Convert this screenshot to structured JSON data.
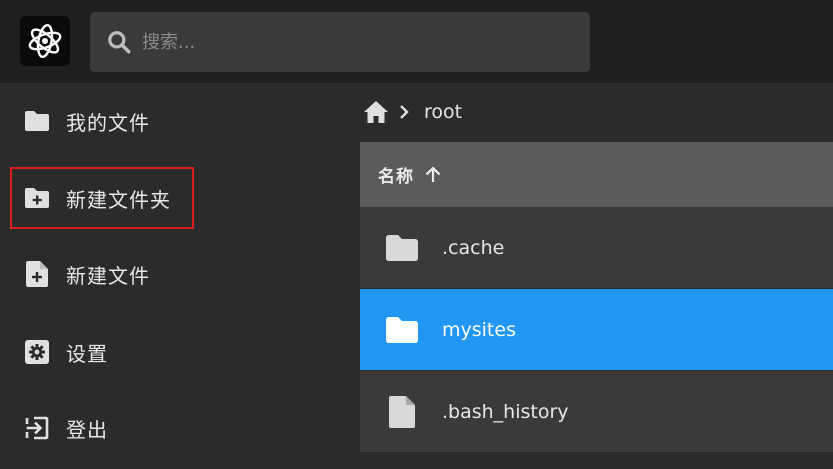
{
  "search": {
    "placeholder": "搜索..."
  },
  "sidebar": {
    "items": [
      {
        "label": "我的文件",
        "icon": "folder-icon"
      },
      {
        "label": "新建文件夹",
        "icon": "folder-plus-icon"
      },
      {
        "label": "新建文件",
        "icon": "file-plus-icon"
      },
      {
        "label": "设置",
        "icon": "gear-icon"
      },
      {
        "label": "登出",
        "icon": "logout-icon"
      }
    ]
  },
  "breadcrumb": {
    "home_icon": "home-icon",
    "path": "root"
  },
  "file_list": {
    "sort_label": "名称",
    "sort_direction_icon": "arrow-up-icon",
    "rows": [
      {
        "name": ".cache",
        "type": "folder",
        "selected": false
      },
      {
        "name": "mysites",
        "type": "folder",
        "selected": true
      },
      {
        "name": ".bash_history",
        "type": "file",
        "selected": false
      }
    ]
  },
  "colors": {
    "topbar": "#1f1f1f",
    "background": "#2b2b2b",
    "row": "#3a3a3a",
    "header": "#5b5b5b",
    "selected": "#2196f3",
    "highlight_box": "#e01b1b"
  }
}
